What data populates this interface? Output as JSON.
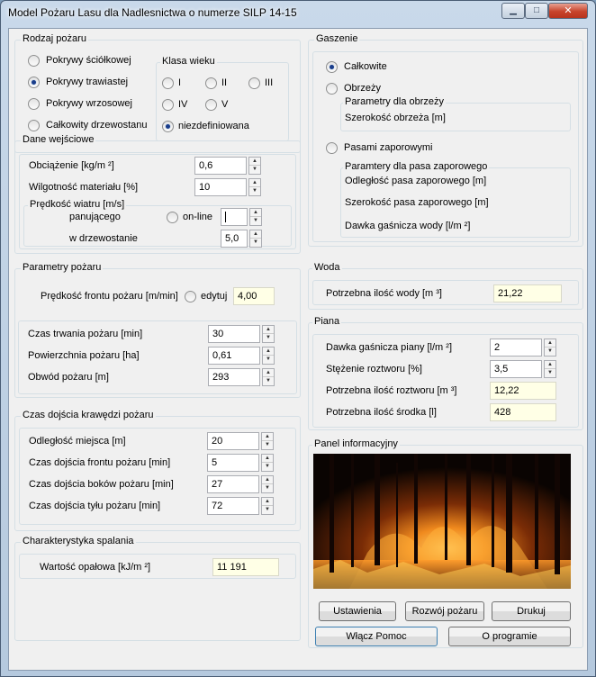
{
  "window": {
    "title": "Model Pożaru Lasu dla Nadlesnictwa o numerze SILP 14-15"
  },
  "rodzaj": {
    "title": "Rodzaj pożaru",
    "options": [
      "Pokrywy ściółkowej",
      "Pokrywy trawiastej",
      "Pokrywy wrzosowej",
      "Całkowity drzewostanu"
    ],
    "selected": "Pokrywy trawiastej",
    "klasa": {
      "title": "Klasa wieku",
      "options": [
        "I",
        "II",
        "III",
        "IV",
        "V",
        "niezdefiniowana"
      ],
      "selected": "niezdefiniowana"
    }
  },
  "dane": {
    "title": "Dane wejściowe",
    "obciazenie_label": "Obciążenie [kg/m ²]",
    "obciazenie_value": "0,6",
    "wilgotnosc_label": "Wilgotność materiału [%]",
    "wilgotnosc_value": "10",
    "wiatr_title": "Prędkość wiatru [m/s]",
    "panujacego_label": "panującego",
    "online_label": "on-line",
    "panujacego_value": "",
    "drzewostanie_label": "w drzewostanie",
    "drzewostanie_value": "5,0"
  },
  "parametry": {
    "title": "Parametry pożaru",
    "predkosc_label": "Prędkość frontu pożaru [m/min]",
    "edytuj_label": "edytuj",
    "predkosc_value": "4,00",
    "czas_label": "Czas trwania pożaru [min]",
    "czas_value": "30",
    "powierzchnia_label": "Powierzchnia pożaru [ha]",
    "powierzchnia_value": "0,61",
    "obwod_label": "Obwód pożaru [m]",
    "obwod_value": "293"
  },
  "dojscie": {
    "title": "Czas dojścia krawędzi pożaru",
    "rows": [
      {
        "label": "Odległość miejsca [m]",
        "value": "20"
      },
      {
        "label": "Czas dojścia frontu pożaru [min]",
        "value": "5"
      },
      {
        "label": "Czas dojścia  boków pożaru  [min]",
        "value": "27"
      },
      {
        "label": "Czas dojścia tyłu pożaru [min]",
        "value": "72"
      }
    ]
  },
  "spalanie": {
    "title": "Charakterystyka spalania",
    "label": "Wartość opałowa [kJ/m ²]",
    "value": "11 191"
  },
  "gaszenie": {
    "title": "Gaszenie",
    "calkowite": "Całkowite",
    "obrzezy": "Obrzeży",
    "selected": "Całkowite",
    "obrzezy_params_title": "Parametry dla obrzeży",
    "szerokosc_obrzeza": "Szerokość obrzeża [m]",
    "pasami": "Pasami zaporowymi",
    "pas_params_title": "Paramtery dla pasa zaporowego",
    "odleglosc_pasa": "Odległość pasa zaporowego [m]",
    "szerokosc_pasa": "Szerokość pasa zaporowego  [m]",
    "dawka_wody": "Dawka gaśnicza wody [l/m ²]"
  },
  "woda": {
    "title": "Woda",
    "label": "Potrzebna ilość wody [m ³]",
    "value": "21,22"
  },
  "piana": {
    "title": "Piana",
    "dawka_label": "Dawka gaśnicza piany [l/m ²]",
    "dawka_value": "2",
    "stezenie_label": "Stężenie roztworu [%]",
    "stezenie_value": "3,5",
    "roztworu_label": "Potrzebna ilość roztworu [m ³]",
    "roztworu_value": "12,22",
    "srodka_label": "Potrzebna ilość środka [l]",
    "srodka_value": "428"
  },
  "panel": {
    "title": "Panel informacyjny"
  },
  "buttons": {
    "ustawienia": "Ustawienia",
    "rozwoj": "Rozwój pożaru",
    "drukuj": "Drukuj",
    "pomoc": "Włącz Pomoc",
    "oprogramie": "O programie"
  }
}
